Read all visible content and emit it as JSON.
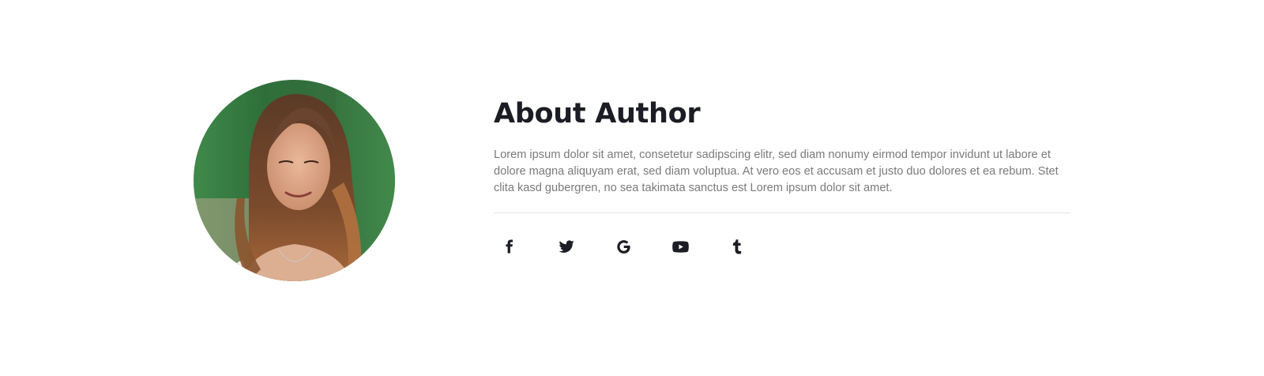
{
  "author": {
    "title": "About Author",
    "bio": "Lorem ipsum dolor sit amet, consetetur sadipscing elitr, sed diam nonumy eirmod tempor invidunt ut labore et dolore magna aliquyam erat, sed diam voluptua. At vero eos et accusam et justo duo dolores et ea rebum. Stet clita kasd gubergren, no sea takimata sanctus est Lorem ipsum dolor sit amet."
  },
  "social": [
    {
      "icon": "facebook-icon"
    },
    {
      "icon": "twitter-icon"
    },
    {
      "icon": "google-icon"
    },
    {
      "icon": "youtube-icon"
    },
    {
      "icon": "tumblr-icon"
    }
  ],
  "colors": {
    "heading": "#1c1d24",
    "text": "#7a7a7a",
    "divider": "#e4e4e4",
    "icon": "#1c1d24"
  }
}
